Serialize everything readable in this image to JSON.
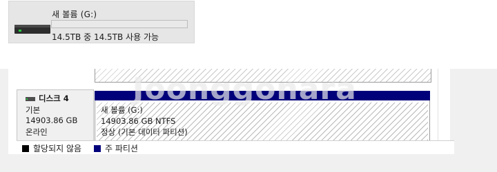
{
  "drive_tile": {
    "name": "새 볼륨 (G:)",
    "usage_text": "14.5TB 중 14.5TB 사용 가능",
    "used_fraction": 0.0,
    "icon": "drive-icon"
  },
  "disk": {
    "name": "디스크 4",
    "type": "기본",
    "capacity": "14903.86 GB",
    "status": "온라인",
    "icon": "disk-icon"
  },
  "partition": {
    "name": "새 볼륨  (G:)",
    "size_fs": "14903.86 GB NTFS",
    "status": "정상 (기본 데이터 파티션)"
  },
  "legend": [
    {
      "label": "할당되지 않음",
      "color": "#000000"
    },
    {
      "label": "주 파티션",
      "color": "#00007a"
    }
  ],
  "watermark": "Joonggonara",
  "colors": {
    "partition_header": "#00007a",
    "progress_fill": "#26a0da"
  }
}
